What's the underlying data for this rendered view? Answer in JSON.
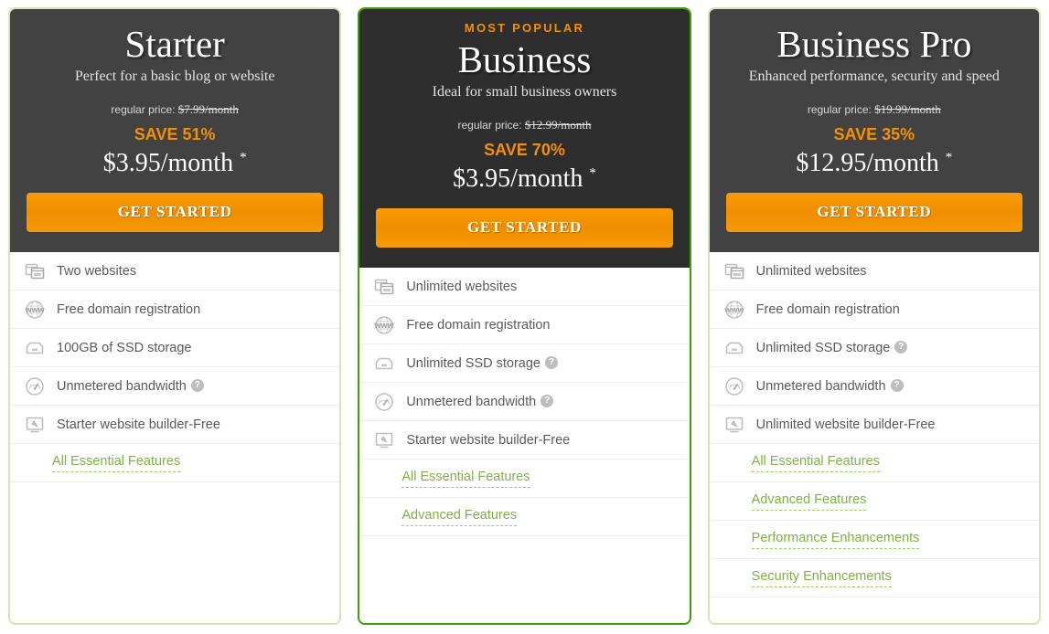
{
  "common": {
    "regular_price_label": "regular price:",
    "cta_label": "GET STARTED",
    "help_glyph": "?",
    "asterisk": "*"
  },
  "plans": [
    {
      "id": "starter",
      "badge": "",
      "name": "Starter",
      "description": "Perfect for a basic blog or website",
      "regular_price": "$7.99/month",
      "save": "SAVE 51%",
      "price": "$3.95/month",
      "cta": "GET STARTED",
      "featured": false,
      "features": [
        {
          "icon": "websites-icon",
          "text": "Two websites",
          "help": false
        },
        {
          "icon": "www-globe-icon",
          "text": "Free domain registration",
          "help": false
        },
        {
          "icon": "ssd-storage-icon",
          "text": "100GB of SSD storage",
          "help": false
        },
        {
          "icon": "bandwidth-gauge-icon",
          "text": "Unmetered bandwidth",
          "help": true
        },
        {
          "icon": "website-builder-icon",
          "text": "Starter website builder-Free",
          "help": false
        }
      ],
      "links": [
        "All Essential Features"
      ]
    },
    {
      "id": "business",
      "badge": "MOST POPULAR",
      "name": "Business",
      "description": "Ideal for small business owners",
      "regular_price": "$12.99/month",
      "save": "SAVE 70%",
      "price": "$3.95/month",
      "cta": "GET STARTED",
      "featured": true,
      "features": [
        {
          "icon": "websites-icon",
          "text": "Unlimited websites",
          "help": false
        },
        {
          "icon": "www-globe-icon",
          "text": "Free domain registration",
          "help": false
        },
        {
          "icon": "ssd-storage-icon",
          "text": "Unlimited SSD storage",
          "help": true
        },
        {
          "icon": "bandwidth-gauge-icon",
          "text": "Unmetered bandwidth",
          "help": true
        },
        {
          "icon": "website-builder-icon",
          "text": "Starter website builder-Free",
          "help": false
        }
      ],
      "links": [
        "All Essential Features",
        "Advanced Features"
      ]
    },
    {
      "id": "business-pro",
      "badge": "",
      "name": "Business Pro",
      "description": "Enhanced performance, security and speed",
      "regular_price": "$19.99/month",
      "save": "SAVE 35%",
      "price": "$12.95/month",
      "cta": "GET STARTED",
      "featured": false,
      "features": [
        {
          "icon": "websites-icon",
          "text": "Unlimited websites",
          "help": false
        },
        {
          "icon": "www-globe-icon",
          "text": "Free domain registration",
          "help": false
        },
        {
          "icon": "ssd-storage-icon",
          "text": "Unlimited SSD storage",
          "help": true
        },
        {
          "icon": "bandwidth-gauge-icon",
          "text": "Unmetered bandwidth",
          "help": true
        },
        {
          "icon": "website-builder-icon",
          "text": "Unlimited website builder-Free",
          "help": false
        }
      ],
      "links": [
        "All Essential Features",
        "Advanced Features",
        "Performance Enhancements",
        "Security Enhancements"
      ]
    }
  ],
  "colors": {
    "accent_orange": "#f59100",
    "link_green": "#7cb342",
    "featured_border": "#3ea000",
    "border_green": "#d4e5b4",
    "header_dark": "#424242",
    "header_featured": "#2e2e2e"
  }
}
